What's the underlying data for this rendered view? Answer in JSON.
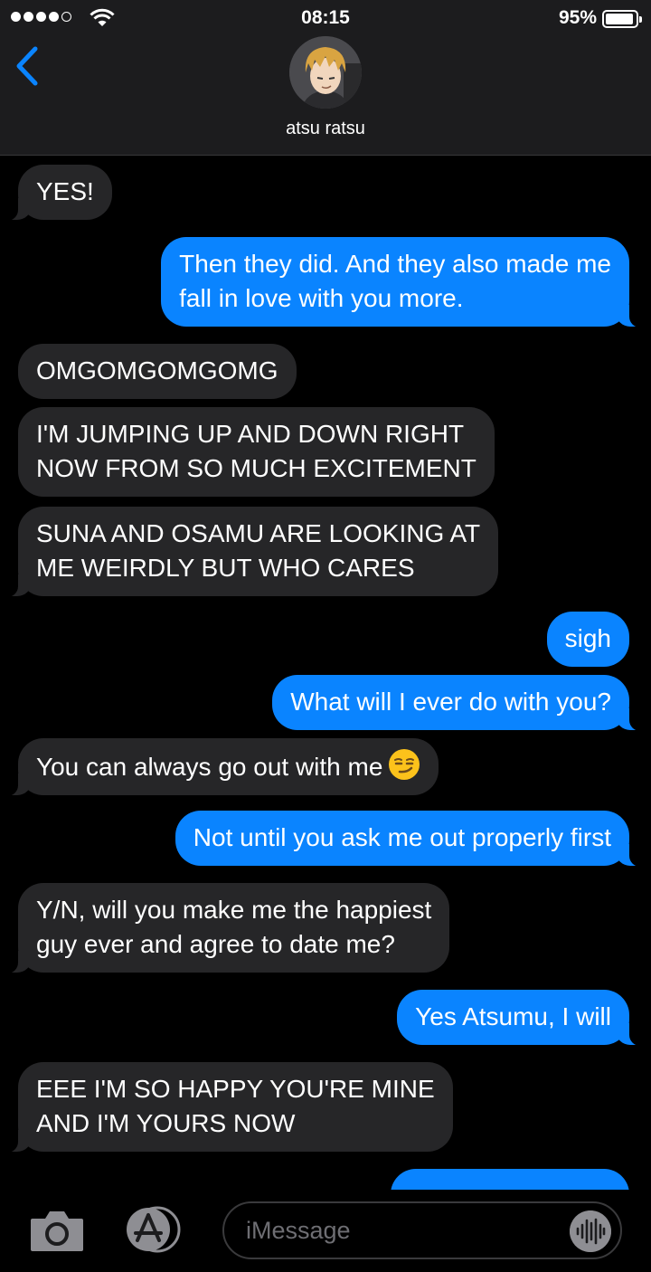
{
  "status_bar": {
    "time": "08:15",
    "battery": "95%"
  },
  "contact": {
    "name": "atsu ratsu"
  },
  "messages": [
    {
      "dir": "in",
      "lines": [
        "YES!"
      ]
    },
    {
      "dir": "out",
      "lines": [
        "Then they did. And they also made me",
        "fall in love with you more."
      ]
    },
    {
      "dir": "in",
      "lines": [
        "OMGOMGOMGOMG"
      ]
    },
    {
      "dir": "in",
      "lines": [
        "I'M JUMPING UP AND DOWN RIGHT",
        "NOW FROM SO MUCH EXCITEMENT"
      ]
    },
    {
      "dir": "in",
      "lines": [
        "SUNA AND OSAMU ARE LOOKING AT",
        "ME WEIRDLY BUT WHO CARES"
      ]
    },
    {
      "dir": "out",
      "lines": [
        "sigh"
      ]
    },
    {
      "dir": "out",
      "lines": [
        "What will I ever do with you?"
      ]
    },
    {
      "dir": "in",
      "lines": [
        "You can always go out with me"
      ],
      "emoji": "smirk-emoji"
    },
    {
      "dir": "out",
      "lines": [
        "Not until you ask me out properly first"
      ]
    },
    {
      "dir": "in",
      "lines": [
        "Y/N, will you make me the happiest",
        "guy ever and agree to date me?"
      ]
    },
    {
      "dir": "out",
      "lines": [
        "Yes Atsumu, I will"
      ]
    },
    {
      "dir": "in",
      "lines": [
        "EEE I'M SO HAPPY YOU'RE MINE",
        "AND I'M YOURS NOW"
      ]
    }
  ],
  "composer": {
    "placeholder": "iMessage"
  },
  "icons": [
    "back-chevron-icon",
    "camera-icon",
    "app-store-icon",
    "audio-waveform-icon",
    "wifi-icon",
    "battery-icon"
  ],
  "colors": {
    "outgoing": "#0a84ff",
    "incoming": "#262628",
    "header": "#1c1c1e",
    "accent": "#0a84ff"
  }
}
